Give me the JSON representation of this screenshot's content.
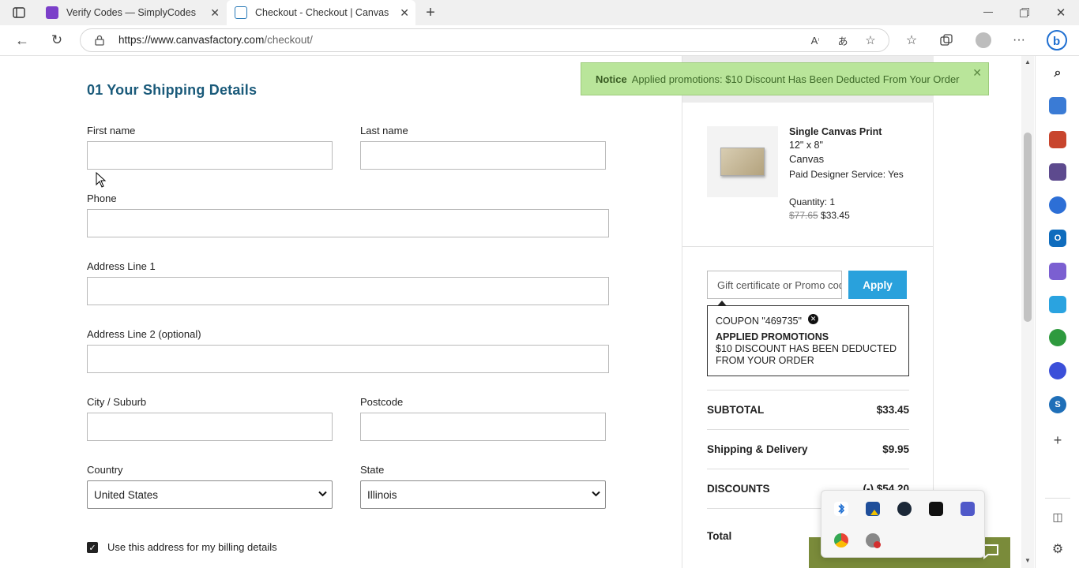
{
  "tabs": [
    {
      "title": "Verify Codes — SimplyCodes",
      "icon": "simplycodes-icon",
      "active": false
    },
    {
      "title": "Checkout - Checkout | Canvas Fa",
      "icon": "canvas-factory-icon",
      "active": true
    }
  ],
  "address_bar": {
    "url_host": "https://www.canvasfactory.com",
    "url_path": "/checkout/"
  },
  "notice": {
    "label": "Notice",
    "message": "Applied promotions: $10 Discount Has Been Deducted From Your Order"
  },
  "form": {
    "section_title": "01  Your Shipping Details",
    "first_name_label": "First name",
    "last_name_label": "Last name",
    "phone_label": "Phone",
    "address1_label": "Address Line 1",
    "address2_label": "Address Line 2 (optional)",
    "city_label": "City / Suburb",
    "postcode_label": "Postcode",
    "country_label": "Country",
    "country_value": "United States",
    "state_label": "State",
    "state_value": "Illinois",
    "billing_checkbox_label": "Use this address for my billing details",
    "billing_checked": true
  },
  "summary": {
    "product_name": "Single Canvas Print",
    "size": "12\" x 8\"",
    "material": "Canvas",
    "designer_service": "Paid Designer Service:  Yes",
    "quantity": "Quantity: 1",
    "old_price": "$77.65",
    "new_price": "$33.45",
    "promo_placeholder": "Gift certificate or Promo code",
    "apply_label": "Apply",
    "coupon_line": "COUPON \"469735\"",
    "applied_title": "APPLIED PROMOTIONS",
    "applied_text": "$10 DISCOUNT HAS BEEN DEDUCTED FROM YOUR ORDER",
    "subtotal_label": "SUBTOTAL",
    "subtotal_value": "$33.45",
    "shipping_label": "Shipping & Delivery",
    "shipping_value": "$9.95",
    "discounts_label": "DISCOUNTS",
    "discounts_value": "(-) $54.20",
    "total_label": "Total"
  },
  "colors": {
    "accent": "#29a1dc",
    "heading": "#1a5a7a",
    "notice_bg": "#b9e59a"
  }
}
